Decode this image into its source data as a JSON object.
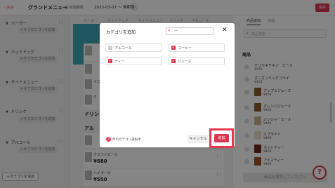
{
  "header": {
    "back_label": "戻る",
    "title": "グランドメニュー",
    "period_label": "有効期間",
    "period_value": "2023-03-07 ～ 無期限",
    "save_label": "保存"
  },
  "sidebar": {
    "categories": [
      {
        "label": "バーガー",
        "sub_label": "＋サブカテゴリを追加"
      },
      {
        "label": "ホットドッグ",
        "sub_label": "＋サブカテゴリを追加"
      },
      {
        "label": "サイドメニュー",
        "sub_label": "＋サブカテゴリを追加"
      },
      {
        "label": "ドリンク",
        "sub_label": "＋サブカテゴリを追加"
      },
      {
        "label": "アルコール",
        "sub_label": "＋サブカテゴリを追加"
      }
    ],
    "add_category_label": "＋カテゴリを追加"
  },
  "center": {
    "tabs": [
      "バーガー",
      "ホットドッグ",
      "サイドメニュー",
      "ドリンク",
      "アルコール"
    ],
    "sections": [
      "ドリン",
      "アル"
    ],
    "items": [
      {
        "name": "イニ",
        "price": ""
      },
      {
        "name": "ク",
        "price": ""
      },
      {
        "name": "",
        "price": ""
      },
      {
        "name": "クラフトビール",
        "price": "¥680"
      },
      {
        "name": "ハイボール",
        "price": "¥550"
      }
    ]
  },
  "right_panel": {
    "tabs": [
      "商品追加",
      "詳細"
    ],
    "search_placeholder": "商品検索",
    "heading": "商品",
    "items": [
      {
        "name": "テリヤキチキン　ピース",
        "price": "¥250"
      },
      {
        "name": "オニオンリングフライ",
        "price": "¥400"
      },
      {
        "name": "アップルジュース",
        "price": "¥400"
      },
      {
        "name": "オレンジジュース",
        "price": "¥400"
      },
      {
        "name": "ジンジャーエール",
        "price": "¥400"
      },
      {
        "name": "スプライト",
        "price": "¥400"
      },
      {
        "name": "ホットティー",
        "price": "¥400"
      },
      {
        "name": "アイスティー",
        "price": "¥400"
      }
    ],
    "select_prompt": "商品を選択してください",
    "help_icon": "?"
  },
  "modal": {
    "title": "カテゴリを追加",
    "search_value": "ー",
    "options": [
      {
        "label": "アルコール",
        "checked": false
      },
      {
        "label": "コーヒー",
        "checked": true
      },
      {
        "label": "ティー",
        "checked": true
      },
      {
        "label": "ジュース",
        "checked": true
      }
    ],
    "selected_count": "3",
    "selected_text": "件のカテゴリ選択中",
    "cancel_label": "キャンセル",
    "add_label": "追加"
  },
  "colors": {
    "accent": "#d9364f",
    "banner": "#3fa8b6"
  },
  "icons": [
    "back-chevron-icon",
    "calendar-icon",
    "gear-icon",
    "search-icon",
    "close-icon",
    "check-icon",
    "help-icon"
  ]
}
